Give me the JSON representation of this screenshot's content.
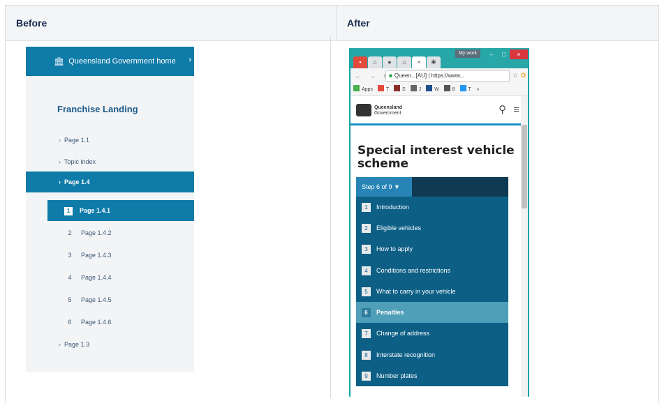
{
  "table": {
    "header_before": "Before",
    "header_after": "After"
  },
  "before": {
    "gov_home": "Queensland Government home",
    "nav_title": "Franchise Landing",
    "items_top": [
      "Page 1.1",
      "Topic index"
    ],
    "active": "Page 1.4",
    "sub_active": {
      "num": "1",
      "label": "Page 1.4.1"
    },
    "sub_items": [
      {
        "num": "2",
        "label": "Page 1.4.2"
      },
      {
        "num": "3",
        "label": "Page 1.4.3"
      },
      {
        "num": "4",
        "label": "Page 1.4.4"
      },
      {
        "num": "5",
        "label": "Page 1.4.5"
      },
      {
        "num": "6",
        "label": "Page 1.4.6"
      }
    ],
    "item_bottom": "Page 1.3"
  },
  "after": {
    "window_label": "My work",
    "address": "Queen...[AU] | https://www...",
    "bookmarks": [
      "Apps",
      "T",
      "S",
      "J",
      "W",
      "8",
      "T"
    ],
    "logo_line1": "Queensland",
    "logo_line2": "Government",
    "title": "Special interest vehicle scheme",
    "step_selector": "Step 6 of 9 ▼",
    "steps": [
      {
        "n": "1",
        "label": "Introduction"
      },
      {
        "n": "2",
        "label": "Eligible vehicles"
      },
      {
        "n": "3",
        "label": "How to apply"
      },
      {
        "n": "4",
        "label": "Conditions and restrictions"
      },
      {
        "n": "5",
        "label": "What to carry in your vehicle"
      },
      {
        "n": "6",
        "label": "Penalties"
      },
      {
        "n": "7",
        "label": "Change of address"
      },
      {
        "n": "8",
        "label": "Interstate recognition"
      },
      {
        "n": "9",
        "label": "Number plates"
      }
    ],
    "current_step": 6
  },
  "colors": {
    "qld_blue": "#0e7ba8",
    "steps_bg": "#0d5f86",
    "chrome": "#27a7a7"
  }
}
